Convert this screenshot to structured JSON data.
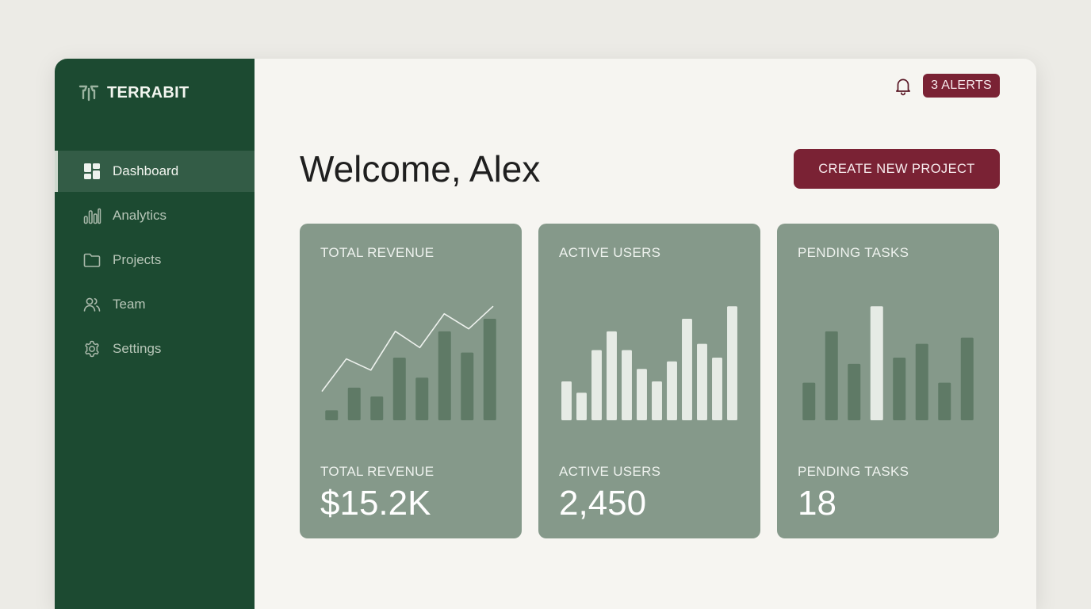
{
  "brand": {
    "name": "TERRABIT"
  },
  "sidebar": {
    "items": [
      {
        "label": "Dashboard",
        "icon": "dashboard-icon",
        "active": true
      },
      {
        "label": "Analytics",
        "icon": "analytics-icon",
        "active": false
      },
      {
        "label": "Projects",
        "icon": "folder-icon",
        "active": false
      },
      {
        "label": "Team",
        "icon": "team-icon",
        "active": false
      },
      {
        "label": "Settings",
        "icon": "gear-icon",
        "active": false
      }
    ]
  },
  "header": {
    "alerts_label": "3 ALERTS",
    "welcome": "Welcome, Alex",
    "create_button": "CREATE NEW PROJECT"
  },
  "colors": {
    "sidebar_bg": "#1c4a31",
    "accent": "#7a2234",
    "card_bg": "#85998a",
    "page_bg": "#f6f5f1"
  },
  "cards": [
    {
      "title": "TOTAL REVENUE",
      "label": "TOTAL REVENUE",
      "value": "$15.2K"
    },
    {
      "title": "ACTIVE USERS",
      "label": "ACTIVE USERS",
      "value": "2,450"
    },
    {
      "title": "PENDING TASKS",
      "label": "PENDING TASKS",
      "value": "18"
    }
  ],
  "chart_data": [
    {
      "type": "bar",
      "title": "TOTAL REVENUE",
      "bar_color": "#5f7a66",
      "values": [
        8,
        26,
        19,
        50,
        34,
        71,
        54,
        81
      ],
      "overlay_line": {
        "color": "#eef2ee",
        "values": [
          23,
          49,
          40,
          71,
          58,
          85,
          73,
          91
        ]
      },
      "ylim": [
        0,
        100
      ]
    },
    {
      "type": "bar",
      "title": "ACTIVE USERS",
      "bar_color": "#e6ebe5",
      "values": [
        31,
        22,
        56,
        71,
        56,
        41,
        31,
        47,
        81,
        61,
        50,
        91
      ],
      "ylim": [
        0,
        100
      ]
    },
    {
      "type": "bar",
      "title": "PENDING TASKS",
      "bar_color": "#5f7a66",
      "highlight_color": "#e6ebe5",
      "highlight_index": 3,
      "values": [
        30,
        71,
        45,
        91,
        50,
        61,
        30,
        66
      ],
      "ylim": [
        0,
        100
      ]
    }
  ]
}
